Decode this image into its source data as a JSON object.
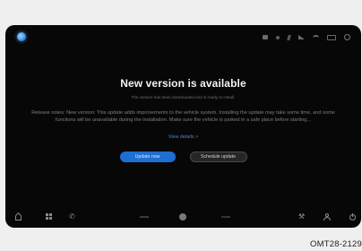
{
  "dialog": {
    "title": "New version is available",
    "subtitle": "The version has been downloaded and is ready to install.",
    "body": "Release notes: New version: This update adds improvements to the vehicle system. Installing the update may take some time, and some functions will be unavailable during the installation. Make sure the vehicle is parked in a safe place before starting...",
    "details_link": "View details >",
    "primary_button": "Update now",
    "secondary_button": "Schedule update"
  },
  "caption": "OMT28-2129",
  "colors": {
    "screen_bg": "#070707",
    "page_bg": "#efefef",
    "accent": "#1f6fd1",
    "link": "#4d87c7"
  },
  "icons": {
    "status": [
      "display-icon",
      "dot-icon",
      "mute-icon",
      "signal-icon",
      "wifi-icon",
      "battery-icon",
      "light-icon"
    ],
    "bottom": [
      "home-icon",
      "apps-grid-icon",
      "phone-icon",
      "fan-icon",
      "media-icon",
      "climate-icon",
      "wrench-icon",
      "profile-icon",
      "power-icon"
    ]
  }
}
